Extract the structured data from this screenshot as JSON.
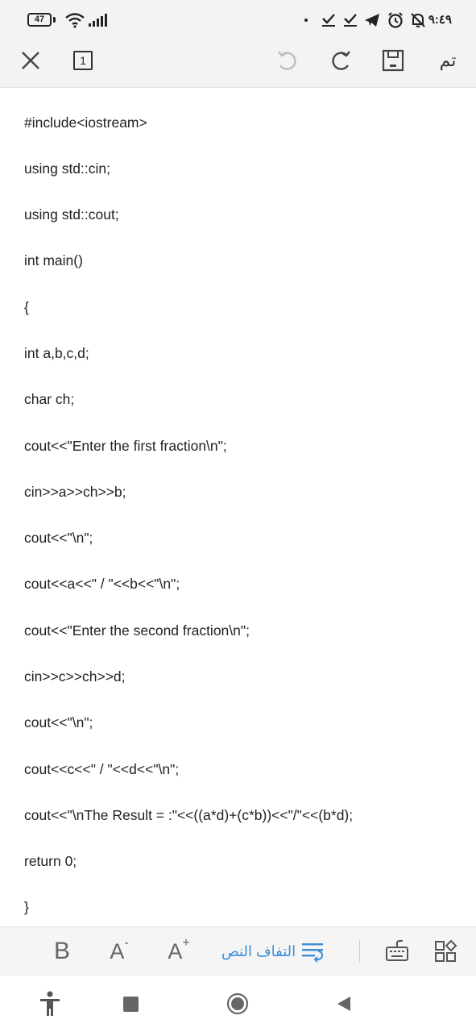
{
  "status": {
    "battery": "47",
    "time": "٩:٤٩"
  },
  "toolbar": {
    "done_label": "تم",
    "page_count": "1"
  },
  "document": {
    "lines": [
      "#include<iostream>",
      "using std::cin;",
      "using std::cout;",
      "int main()",
      "{",
      "int a,b,c,d;",
      "char ch;",
      "cout<<\"Enter the first fraction\\n\";",
      "cin>>a>>ch>>b;",
      "cout<<\"\\n\";",
      "cout<<a<<\" / \"<<b<<\"\\n\";",
      "cout<<\"Enter the second fraction\\n\";",
      "cin>>c>>ch>>d;",
      "cout<<\"\\n\";",
      "cout<<c<<\" / \"<<d<<\"\\n\";",
      "cout<<\"\\nThe Result = :\"<<((a*d)+(c*b))<<\"/\"<<(b*d);",
      "return 0;",
      "}"
    ]
  },
  "format_bar": {
    "bold_label": "B",
    "decrease_label": "A",
    "increase_label": "A",
    "wrap_label": "التفاف النص"
  },
  "colors": {
    "accent": "#3a8fd6",
    "toolbar_bg": "#f3f3f3"
  }
}
